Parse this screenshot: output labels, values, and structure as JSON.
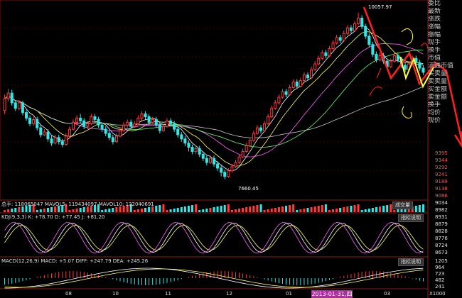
{
  "main_chart": {
    "high_label": "10057.97",
    "low_label": "7660.45",
    "price_range": [
      7400,
      10200
    ]
  },
  "candles": [
    [
      8650,
      8820,
      8600,
      8880
    ],
    [
      8820,
      8900,
      8780,
      8960
    ],
    [
      8900,
      8760,
      8720,
      8950
    ],
    [
      8760,
      8680,
      8640,
      8800
    ],
    [
      8680,
      8760,
      8650,
      8800
    ],
    [
      8760,
      8620,
      8580,
      8790
    ],
    [
      8620,
      8540,
      8500,
      8660
    ],
    [
      8540,
      8460,
      8420,
      8580
    ],
    [
      8460,
      8520,
      8430,
      8560
    ],
    [
      8520,
      8400,
      8360,
      8560
    ],
    [
      8400,
      8300,
      8260,
      8440
    ],
    [
      8300,
      8340,
      8280,
      8380
    ],
    [
      8340,
      8240,
      8200,
      8380
    ],
    [
      8240,
      8180,
      8140,
      8300
    ],
    [
      8180,
      8260,
      8160,
      8300
    ],
    [
      8260,
      8200,
      8160,
      8300
    ],
    [
      8200,
      8160,
      8120,
      8240
    ],
    [
      8160,
      8280,
      8140,
      8320
    ],
    [
      8280,
      8380,
      8260,
      8420
    ],
    [
      8380,
      8480,
      8360,
      8520
    ],
    [
      8480,
      8540,
      8440,
      8580
    ],
    [
      8540,
      8500,
      8460,
      8600
    ],
    [
      8500,
      8420,
      8380,
      8540
    ],
    [
      8420,
      8460,
      8380,
      8500
    ],
    [
      8460,
      8560,
      8440,
      8600
    ],
    [
      8560,
      8520,
      8480,
      8600
    ],
    [
      8520,
      8440,
      8400,
      8560
    ],
    [
      8440,
      8380,
      8340,
      8480
    ],
    [
      8380,
      8320,
      8280,
      8420
    ],
    [
      8320,
      8260,
      8220,
      8360
    ],
    [
      8260,
      8200,
      8160,
      8300
    ],
    [
      8200,
      8280,
      8180,
      8320
    ],
    [
      8280,
      8360,
      8260,
      8400
    ],
    [
      8360,
      8440,
      8340,
      8480
    ],
    [
      8440,
      8480,
      8400,
      8520
    ],
    [
      8480,
      8420,
      8380,
      8520
    ],
    [
      8420,
      8460,
      8400,
      8500
    ],
    [
      8460,
      8540,
      8440,
      8580
    ],
    [
      8540,
      8600,
      8500,
      8640
    ],
    [
      8600,
      8560,
      8520,
      8640
    ],
    [
      8560,
      8480,
      8440,
      8600
    ],
    [
      8480,
      8520,
      8460,
      8560
    ],
    [
      8520,
      8440,
      8400,
      8560
    ],
    [
      8440,
      8360,
      8320,
      8480
    ],
    [
      8360,
      8420,
      8340,
      8460
    ],
    [
      8420,
      8500,
      8400,
      8540
    ],
    [
      8500,
      8460,
      8420,
      8540
    ],
    [
      8460,
      8380,
      8340,
      8500
    ],
    [
      8380,
      8300,
      8260,
      8420
    ],
    [
      8300,
      8240,
      8200,
      8340
    ],
    [
      8240,
      8180,
      8140,
      8280
    ],
    [
      8180,
      8120,
      8060,
      8220
    ],
    [
      8120,
      8060,
      8020,
      8160
    ],
    [
      8060,
      8100,
      8020,
      8140
    ],
    [
      8100,
      8020,
      7980,
      8140
    ],
    [
      8020,
      7960,
      7920,
      8060
    ],
    [
      7960,
      7900,
      7860,
      8000
    ],
    [
      7900,
      7960,
      7880,
      8000
    ],
    [
      7960,
      7880,
      7840,
      8000
    ],
    [
      7880,
      7820,
      7780,
      7920
    ],
    [
      7820,
      7760,
      7700,
      7860
    ],
    [
      7760,
      7700,
      7660,
      7800
    ],
    [
      7700,
      7780,
      7680,
      7820
    ],
    [
      7780,
      7840,
      7760,
      7880
    ],
    [
      7840,
      7900,
      7820,
      7940
    ],
    [
      7900,
      7980,
      7880,
      8020
    ],
    [
      7980,
      8060,
      7960,
      8100
    ],
    [
      8060,
      8140,
      8040,
      8180
    ],
    [
      8140,
      8220,
      8120,
      8260
    ],
    [
      8220,
      8320,
      8200,
      8360
    ],
    [
      8320,
      8400,
      8300,
      8440
    ],
    [
      8400,
      8360,
      8320,
      8440
    ],
    [
      8360,
      8460,
      8340,
      8500
    ],
    [
      8460,
      8560,
      8440,
      8600
    ],
    [
      8560,
      8680,
      8540,
      8720
    ],
    [
      8680,
      8760,
      8660,
      8800
    ],
    [
      8760,
      8840,
      8740,
      8880
    ],
    [
      8840,
      8920,
      8820,
      8960
    ],
    [
      8920,
      8880,
      8840,
      8960
    ],
    [
      8880,
      8980,
      8860,
      9020
    ],
    [
      8980,
      9060,
      8960,
      9100
    ],
    [
      9060,
      9000,
      8960,
      9100
    ],
    [
      9000,
      9080,
      8980,
      9120
    ],
    [
      9080,
      9160,
      9060,
      9200
    ],
    [
      9160,
      9120,
      9080,
      9200
    ],
    [
      9120,
      9240,
      9100,
      9280
    ],
    [
      9240,
      9320,
      9220,
      9360
    ],
    [
      9320,
      9400,
      9300,
      9440
    ],
    [
      9400,
      9480,
      9380,
      9520
    ],
    [
      9480,
      9440,
      9400,
      9520
    ],
    [
      9440,
      9540,
      9420,
      9580
    ],
    [
      9540,
      9620,
      9520,
      9660
    ],
    [
      9620,
      9700,
      9600,
      9740
    ],
    [
      9700,
      9660,
      9620,
      9740
    ],
    [
      9660,
      9760,
      9640,
      9800
    ],
    [
      9760,
      9840,
      9740,
      9880
    ],
    [
      9840,
      9800,
      9760,
      9880
    ],
    [
      9800,
      9900,
      9780,
      9940
    ],
    [
      9900,
      9980,
      9880,
      10058
    ],
    [
      9980,
      9860,
      9820,
      10020
    ],
    [
      9860,
      9720,
      9680,
      9900
    ],
    [
      9720,
      9600,
      9560,
      9760
    ],
    [
      9600,
      9460,
      9420,
      9640
    ],
    [
      9460,
      9380,
      9340,
      9500
    ],
    [
      9380,
      9440,
      9360,
      9480
    ],
    [
      9440,
      9360,
      9320,
      9480
    ],
    [
      9360,
      9280,
      9240,
      9400
    ],
    [
      9280,
      9360,
      9260,
      9400
    ],
    [
      9360,
      9440,
      9340,
      9480
    ],
    [
      9440,
      9380,
      9340,
      9480
    ],
    [
      9380,
      9300,
      9260,
      9420
    ],
    [
      9300,
      9240,
      9200,
      9340
    ],
    [
      9240,
      9320,
      9220,
      9360
    ],
    [
      9320,
      9400,
      9300,
      9440
    ],
    [
      9400,
      9340,
      9300,
      9440
    ],
    [
      9340,
      9260,
      9220,
      9380
    ],
    [
      9260,
      9200,
      9160,
      9300
    ]
  ],
  "volume_legend": {
    "text": "总手: 118065047  MAVOL5: 119434097  MAVOL10: 132040691",
    "button": "成交量"
  },
  "kdj_legend": {
    "text": "KDJ(9,3,3) K: +78.70  D: +77.45  J: +81.20",
    "button": "指标说明"
  },
  "macd_legend": {
    "text": "MACD(12,26,9) MACD: +5.07  DIFF: +247.79  DEA: +245.26",
    "button": "指标说明"
  },
  "x_axis": {
    "labels": [
      "08",
      "10",
      "11",
      "12",
      "01",
      "03"
    ],
    "highlight_date": "2013-01-31,四"
  },
  "sidebar": {
    "items": [
      "委比",
      "最新",
      "涨跌",
      "涨幅",
      "振幅",
      "现手",
      "换手",
      "市值",
      "流通市值",
      "买卖量",
      "卖卖量",
      "买金额",
      "卖金额",
      "换手",
      "均价",
      "现价"
    ]
  },
  "right_panel": {
    "price_ticks": [
      "9395",
      "9344",
      "9292",
      "9241",
      "9189",
      "9138",
      "9086",
      "9034",
      "8982",
      "8931",
      "8879",
      "8828",
      "8776",
      "8724",
      "8673"
    ],
    "mini_ticks": [
      "1205",
      "964",
      "723",
      "482",
      "241"
    ],
    "mini_label": "X1000"
  },
  "colors": {
    "up": "#ff3b3b",
    "down": "#33e6e6",
    "ma5": "#ffffff",
    "ma10": "#ffff66",
    "ma20": "#ff66ff",
    "ma30": "#66ff66",
    "ma60": "#c8c8c8",
    "annotation_red": "#ff2020",
    "annotation_yellow": "#ffff40"
  }
}
